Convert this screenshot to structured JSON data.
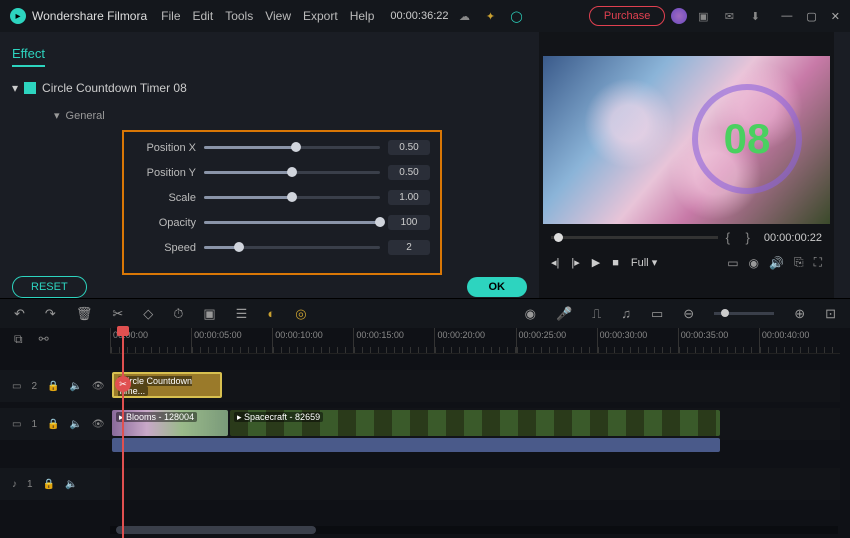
{
  "app": {
    "name": "Wondershare Filmora",
    "timecode": "00:00:36:22"
  },
  "menu": {
    "file": "File",
    "edit": "Edit",
    "tools": "Tools",
    "view": "View",
    "export": "Export",
    "help": "Help"
  },
  "titlebar": {
    "purchase": "Purchase"
  },
  "panel": {
    "tab": "Effect",
    "effectName": "Circle Countdown Timer 08",
    "section": "General",
    "reset": "RESET",
    "ok": "OK",
    "controls": {
      "posX": {
        "label": "Position X",
        "value": "0.50",
        "pct": 52
      },
      "posY": {
        "label": "Position Y",
        "value": "0.50",
        "pct": 50
      },
      "scale": {
        "label": "Scale",
        "value": "1.00",
        "pct": 50
      },
      "opacity": {
        "label": "Opacity",
        "value": "100",
        "pct": 100
      },
      "speed": {
        "label": "Speed",
        "value": "2",
        "pct": 20
      }
    }
  },
  "preview": {
    "countdown": "08",
    "time": "00:00:00:22",
    "quality": "Full"
  },
  "timeline": {
    "marks": [
      "00:00:00",
      "00:00:05:00",
      "00:00:10:00",
      "00:00:15:00",
      "00:00:20:00",
      "00:00:25:00",
      "00:00:30:00",
      "00:00:35:00",
      "00:00:40:00"
    ],
    "tracks": {
      "fx": {
        "label": "2",
        "clip": "Circle Countdown Time..."
      },
      "video": {
        "label": "1",
        "clip1": "Blooms - 128004",
        "clip2": "Spacecraft - 82659"
      },
      "audio": {
        "label": "1"
      }
    }
  }
}
